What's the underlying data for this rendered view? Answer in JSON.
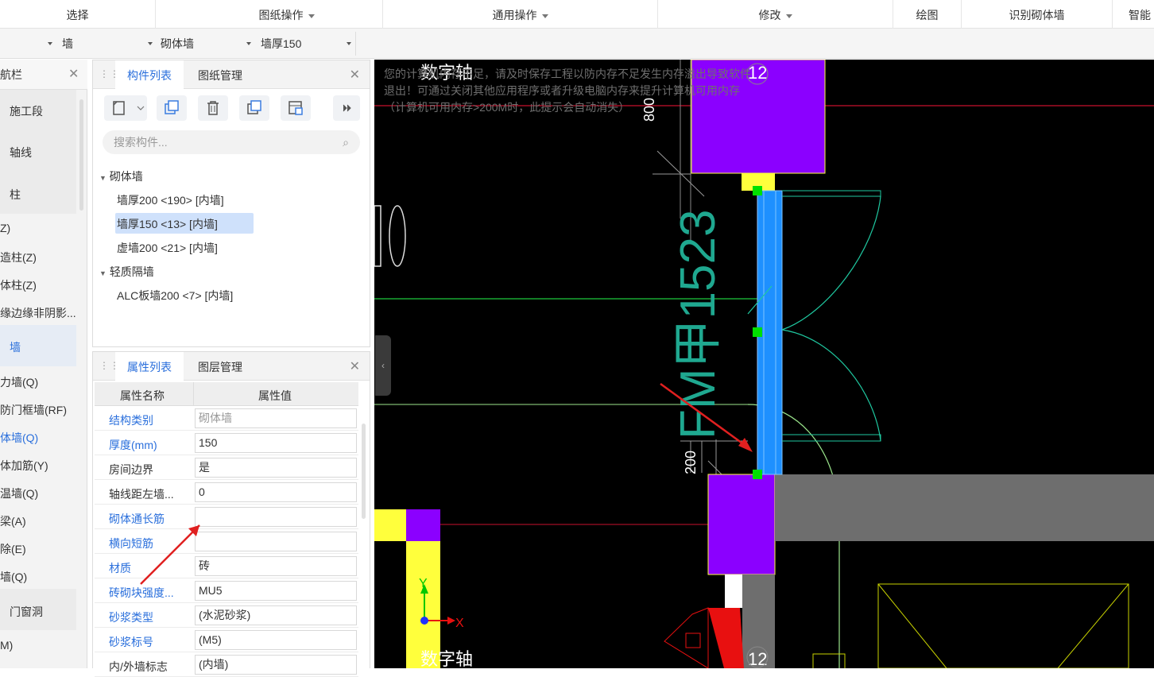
{
  "ribbon": {
    "select": "选择",
    "drawing_ops": "图纸操作",
    "general_ops": "通用操作",
    "modify": "修改",
    "draw": "绘图",
    "recognize": "识别砌体墙",
    "smart": "智能"
  },
  "toolbar2": {
    "combo1": "",
    "combo2": "墙",
    "combo3": "砌体墙",
    "combo4": "墙厚150"
  },
  "nav": {
    "title": "航栏",
    "items": [
      "施工段",
      "轴线",
      "柱",
      "Z)",
      "造柱(Z)",
      "体柱(Z)",
      "缘边缘非阴影...",
      "墙",
      "力墙(Q)",
      "防门框墙(RF)",
      "体墙(Q)",
      "体加筋(Y)",
      "温墙(Q)",
      "梁(A)",
      "除(E)",
      "墙(Q)",
      "门窗洞",
      "M)"
    ]
  },
  "component_panel": {
    "tab_active": "构件列表",
    "tab_other": "图纸管理",
    "search_placeholder": "搜索构件...",
    "groups": [
      {
        "name": "砌体墙",
        "items": [
          "墙厚200 <190> [内墙]",
          "墙厚150 <13> [内墙]",
          "虚墙200 <21> [内墙]"
        ]
      },
      {
        "name": "轻质隔墙",
        "items": [
          "ALC板墙200 <7> [内墙]"
        ]
      }
    ]
  },
  "property_panel": {
    "tab_active": "属性列表",
    "tab_other": "图层管理",
    "col_name": "属性名称",
    "col_value": "属性值",
    "rows": [
      {
        "name": "结构类别",
        "value": "砌体墙"
      },
      {
        "name": "厚度(mm)",
        "value": "150"
      },
      {
        "name": "房间边界",
        "value": "是"
      },
      {
        "name": "轴线距左墙...",
        "value": "0"
      },
      {
        "name": "砌体通长筋",
        "value": ""
      },
      {
        "name": "横向短筋",
        "value": ""
      },
      {
        "name": "材质",
        "value": "砖"
      },
      {
        "name": "砖砌块强度...",
        "value": "MU5"
      },
      {
        "name": "砂浆类型",
        "value": "(水泥砂浆)"
      },
      {
        "name": "砂浆标号",
        "value": "(M5)"
      },
      {
        "name": "内/外墙标志",
        "value": "(内墙)"
      }
    ]
  },
  "canvas": {
    "tip": "您的计算机内存不足，请及时保存工程以防内存不足发生内存溢出导致软件退出！可通过关闭其他应用程序或者升级电脑内存来提升计算机可用内存（计算机可用内存>200M时，此提示会自动消失）",
    "axis_label_top": "数字轴",
    "axis_label_bottom": "数字轴",
    "axis_num_top": "12",
    "axis_num_bottom": "12",
    "dim_800": "800",
    "dim_200": "200",
    "door_text": "FM甲1523",
    "axis_y": "Y",
    "axis_x": "X"
  },
  "colors": {
    "accent": "#2a6fdc",
    "column_purple": "#8b00ff",
    "wall_blue": "#1e90ff",
    "axis_red": "#c8102e",
    "door_green": "#1fc8a0",
    "yellow": "#ffff3c",
    "gray_wall": "#6e6e6e"
  }
}
